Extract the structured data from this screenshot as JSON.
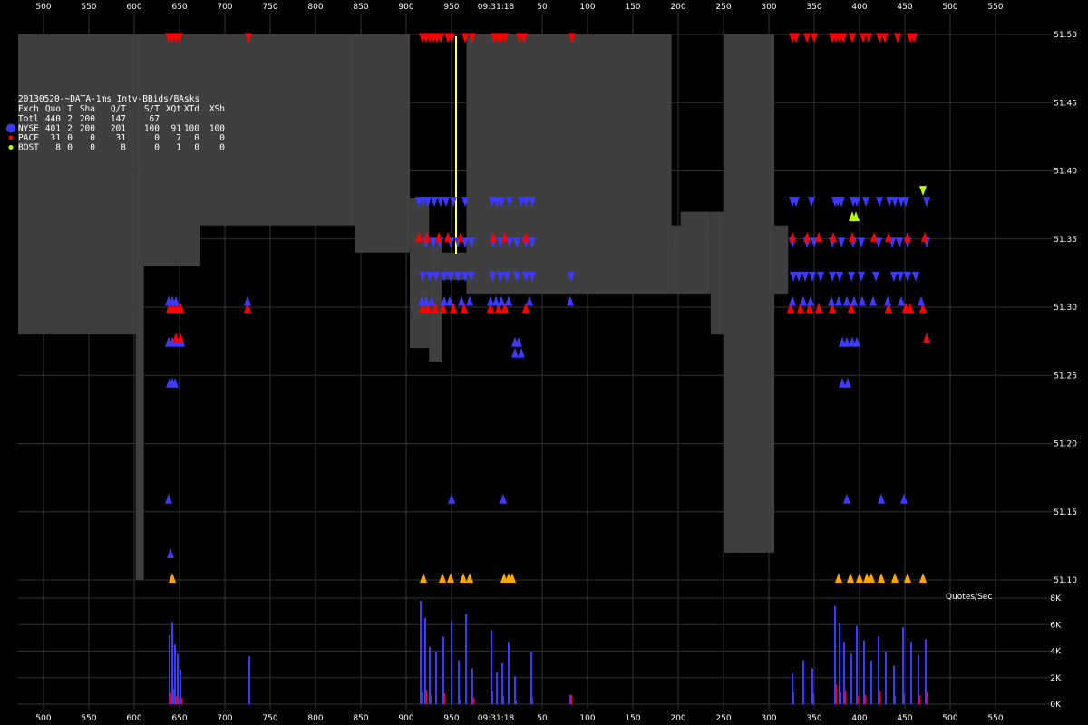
{
  "chart_data": {
    "type": "area",
    "title": "20130520-~DATA-1ms Intv-BBids/BAsks",
    "time_marker": "09:31:18",
    "x_ticks_left": [
      "500",
      "550",
      "600",
      "650",
      "700",
      "750",
      "800",
      "850",
      "900",
      "950"
    ],
    "x_ticks_right": [
      "50",
      "100",
      "150",
      "200",
      "250",
      "300",
      "350",
      "400",
      "450",
      "500",
      "550"
    ],
    "y_ticks": [
      "51.50",
      "51.45",
      "51.40",
      "51.35",
      "51.30",
      "51.25",
      "51.20",
      "51.15",
      "51.10"
    ],
    "ylim": [
      51.1,
      51.5
    ],
    "volume_label": "Quotes/Sec",
    "volume_ticks": [
      "8K",
      "6K",
      "4K",
      "2K",
      "0K"
    ],
    "volume_ylim": [
      0,
      8000
    ],
    "table": {
      "header": [
        "Exch",
        "Quo",
        "T",
        "Sha",
        "Q/T",
        "S/T",
        "XQt",
        "XTd",
        "XSh"
      ],
      "rows": [
        {
          "exch": "Totl",
          "quo": "440",
          "t": "2",
          "sha": "200",
          "qt": "147",
          "st": "67",
          "xqt": "",
          "xtd": "",
          "xsh": "",
          "color": ""
        },
        {
          "exch": "NYSE",
          "quo": "401",
          "t": "2",
          "sha": "200",
          "qt": "201",
          "st": "100",
          "xqt": "91",
          "xtd": "100",
          "xsh": "100",
          "color": "#3b3bff"
        },
        {
          "exch": "PACF",
          "quo": "31",
          "t": "0",
          "sha": "0",
          "qt": "31",
          "st": "0",
          "xqt": "7",
          "xtd": "0",
          "xsh": "0",
          "color": "#ff0000"
        },
        {
          "exch": "BOST",
          "quo": "8",
          "t": "0",
          "sha": "0",
          "qt": "8",
          "st": "0",
          "xqt": "1",
          "xtd": "0",
          "xsh": "0",
          "color": "#b4ff00"
        }
      ]
    },
    "colors": {
      "spread": "#3f3f3f",
      "nyse": "#3b3bff",
      "pacf": "#ff0000",
      "bost": "#b4ff00",
      "trade_marker": "#ffa500",
      "time_line": "#ffff66",
      "grid": "#333333"
    },
    "spread_segments": [
      {
        "t0": 0.0,
        "t1": 0.129,
        "bid": 51.28,
        "ask": 51.5
      },
      {
        "t0": 0.129,
        "t1": 0.138,
        "bid": 51.1,
        "ask": 51.5
      },
      {
        "t0": 0.138,
        "t1": 0.2,
        "bid": 51.33,
        "ask": 51.5
      },
      {
        "t0": 0.2,
        "t1": 0.37,
        "bid": 51.36,
        "ask": 51.5
      },
      {
        "t0": 0.37,
        "t1": 0.43,
        "bid": 51.34,
        "ask": 51.5
      },
      {
        "t0": 0.43,
        "t1": 0.451,
        "bid": 51.27,
        "ask": 51.38
      },
      {
        "t0": 0.451,
        "t1": 0.465,
        "bid": 51.26,
        "ask": 51.35
      },
      {
        "t0": 0.465,
        "t1": 0.492,
        "bid": 51.32,
        "ask": 51.34
      },
      {
        "t0": 0.492,
        "t1": 0.717,
        "bid": 51.31,
        "ask": 51.5
      },
      {
        "t0": 0.717,
        "t1": 0.727,
        "bid": 51.31,
        "ask": 51.36
      },
      {
        "t0": 0.727,
        "t1": 0.76,
        "bid": 51.31,
        "ask": 51.37
      },
      {
        "t0": 0.76,
        "t1": 0.775,
        "bid": 51.28,
        "ask": 51.37
      },
      {
        "t0": 0.775,
        "t1": 0.79,
        "bid": 51.12,
        "ask": 51.5
      },
      {
        "t0": 0.79,
        "t1": 0.83,
        "bid": 51.12,
        "ask": 51.5
      },
      {
        "t0": 0.83,
        "t1": 0.845,
        "bid": 51.31,
        "ask": 51.36
      }
    ],
    "volume_bars": [
      {
        "x": 186,
        "nyse": 5200,
        "pacf": 800
      },
      {
        "x": 189,
        "nyse": 6200,
        "pacf": 1200
      },
      {
        "x": 192,
        "nyse": 4500,
        "pacf": 600
      },
      {
        "x": 195,
        "nyse": 3800,
        "pacf": 400
      },
      {
        "x": 198,
        "nyse": 2600,
        "pacf": 500
      },
      {
        "x": 274,
        "nyse": 3600,
        "pacf": 0
      },
      {
        "x": 463,
        "nyse": 7800,
        "pacf": 900
      },
      {
        "x": 468,
        "nyse": 6500,
        "pacf": 1100
      },
      {
        "x": 473,
        "nyse": 4300,
        "pacf": 700
      },
      {
        "x": 480,
        "nyse": 3900,
        "pacf": 0
      },
      {
        "x": 488,
        "nyse": 5100,
        "pacf": 800
      },
      {
        "x": 497,
        "nyse": 6300,
        "pacf": 0
      },
      {
        "x": 505,
        "nyse": 3300,
        "pacf": 400
      },
      {
        "x": 513,
        "nyse": 6800,
        "pacf": 0
      },
      {
        "x": 520,
        "nyse": 2700,
        "pacf": 500
      },
      {
        "x": 541,
        "nyse": 5600,
        "pacf": 1000
      },
      {
        "x": 547,
        "nyse": 2400,
        "pacf": 0
      },
      {
        "x": 553,
        "nyse": 3100,
        "pacf": 600
      },
      {
        "x": 560,
        "nyse": 4700,
        "pacf": 0
      },
      {
        "x": 567,
        "nyse": 2100,
        "pacf": 300
      },
      {
        "x": 585,
        "nyse": 3900,
        "pacf": 500
      },
      {
        "x": 628,
        "nyse": 700,
        "pacf": 700
      },
      {
        "x": 873,
        "nyse": 2300,
        "pacf": 900
      },
      {
        "x": 885,
        "nyse": 3300,
        "pacf": 0
      },
      {
        "x": 895,
        "nyse": 2700,
        "pacf": 800
      },
      {
        "x": 920,
        "nyse": 7400,
        "pacf": 1500
      },
      {
        "x": 925,
        "nyse": 6100,
        "pacf": 900
      },
      {
        "x": 930,
        "nyse": 4700,
        "pacf": 1000
      },
      {
        "x": 938,
        "nyse": 3800,
        "pacf": 0
      },
      {
        "x": 944,
        "nyse": 5900,
        "pacf": 600
      },
      {
        "x": 952,
        "nyse": 4800,
        "pacf": 700
      },
      {
        "x": 960,
        "nyse": 3300,
        "pacf": 0
      },
      {
        "x": 968,
        "nyse": 5100,
        "pacf": 1000
      },
      {
        "x": 976,
        "nyse": 3900,
        "pacf": 0
      },
      {
        "x": 985,
        "nyse": 2900,
        "pacf": 600
      },
      {
        "x": 995,
        "nyse": 5800,
        "pacf": 800
      },
      {
        "x": 1004,
        "nyse": 4700,
        "pacf": 0
      },
      {
        "x": 1012,
        "nyse": 3700,
        "pacf": 700
      },
      {
        "x": 1020,
        "nyse": 4900,
        "pacf": 900
      }
    ]
  }
}
